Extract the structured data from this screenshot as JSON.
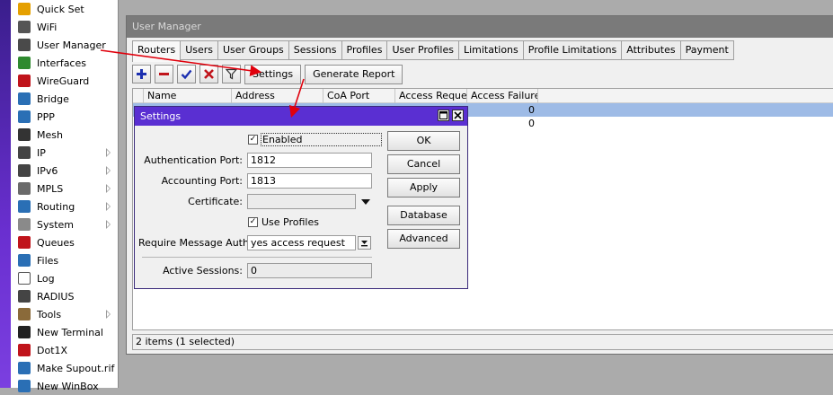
{
  "sidebar": {
    "items": [
      {
        "label": "Quick Set",
        "icon": "quick-set-icon",
        "color": "#e5a000",
        "submenu": false
      },
      {
        "label": "WiFi",
        "icon": "wifi-icon",
        "color": "#555555",
        "submenu": false
      },
      {
        "label": "User Manager",
        "icon": "user-manager-icon",
        "color": "#4a4a4a",
        "submenu": false
      },
      {
        "label": "Interfaces",
        "icon": "interfaces-icon",
        "color": "#2f8a2f",
        "submenu": false
      },
      {
        "label": "WireGuard",
        "icon": "wireguard-icon",
        "color": "#c0141b",
        "submenu": false
      },
      {
        "label": "Bridge",
        "icon": "bridge-icon",
        "color": "#2a6fb5",
        "submenu": false
      },
      {
        "label": "PPP",
        "icon": "ppp-icon",
        "color": "#2a6fb5",
        "submenu": false
      },
      {
        "label": "Mesh",
        "icon": "mesh-icon",
        "color": "#333333",
        "submenu": false
      },
      {
        "label": "IP",
        "icon": "ip-icon",
        "color": "#444444",
        "submenu": true
      },
      {
        "label": "IPv6",
        "icon": "ipv6-icon",
        "color": "#444444",
        "submenu": true
      },
      {
        "label": "MPLS",
        "icon": "mpls-icon",
        "color": "#6a6a6a",
        "submenu": true
      },
      {
        "label": "Routing",
        "icon": "routing-icon",
        "color": "#2a6fb5",
        "submenu": true
      },
      {
        "label": "System",
        "icon": "system-icon",
        "color": "#8a8a8a",
        "submenu": true
      },
      {
        "label": "Queues",
        "icon": "queues-icon",
        "color": "#c0141b",
        "submenu": false
      },
      {
        "label": "Files",
        "icon": "files-icon",
        "color": "#2a6fb5",
        "submenu": false
      },
      {
        "label": "Log",
        "icon": "log-icon",
        "color": "#ffffff",
        "submenu": false
      },
      {
        "label": "RADIUS",
        "icon": "radius-icon",
        "color": "#444444",
        "submenu": false
      },
      {
        "label": "Tools",
        "icon": "tools-icon",
        "color": "#8a6a3a",
        "submenu": true
      },
      {
        "label": "New Terminal",
        "icon": "terminal-icon",
        "color": "#222222",
        "submenu": false
      },
      {
        "label": "Dot1X",
        "icon": "dot1x-icon",
        "color": "#c0141b",
        "submenu": false
      },
      {
        "label": "Make Supout.rif",
        "icon": "supout-icon",
        "color": "#2a6fb5",
        "submenu": false
      },
      {
        "label": "New WinBox",
        "icon": "winbox-icon",
        "color": "#2a6fb5",
        "submenu": false
      }
    ]
  },
  "um_window": {
    "title": "User Manager",
    "tabs": [
      "Routers",
      "Users",
      "User Groups",
      "Sessions",
      "Profiles",
      "User Profiles",
      "Limitations",
      "Profile Limitations",
      "Attributes",
      "Payment"
    ],
    "active_tab": "Routers",
    "toolbar": {
      "settings_label": "Settings",
      "generate_report_label": "Generate Report"
    },
    "table": {
      "columns": [
        "Name",
        "Address",
        "CoA Port",
        "Access Reque...",
        "Access Failures"
      ],
      "rows": [
        {
          "access_failures": "0",
          "selected": true
        },
        {
          "access_failures": "0",
          "selected": false
        }
      ]
    },
    "status": "2 items (1 selected)"
  },
  "settings_dialog": {
    "title": "Settings",
    "enabled_label": "Enabled",
    "enabled_checked": true,
    "auth_port_label": "Authentication Port:",
    "auth_port_value": "1812",
    "acct_port_label": "Accounting Port:",
    "acct_port_value": "1813",
    "certificate_label": "Certificate:",
    "certificate_value": "",
    "use_profiles_label": "Use Profiles",
    "use_profiles_checked": true,
    "require_msg_auth_label": "Require Message Auth:",
    "require_msg_auth_value": "yes access request",
    "active_sessions_label": "Active Sessions:",
    "active_sessions_value": "0",
    "buttons": {
      "ok": "OK",
      "cancel": "Cancel",
      "apply": "Apply",
      "database": "Database",
      "advanced": "Advanced"
    }
  },
  "colors": {
    "accent_purple": "#5a2fd2",
    "selection_blue": "#9ebbe6",
    "annotation_red": "#e0000c"
  }
}
